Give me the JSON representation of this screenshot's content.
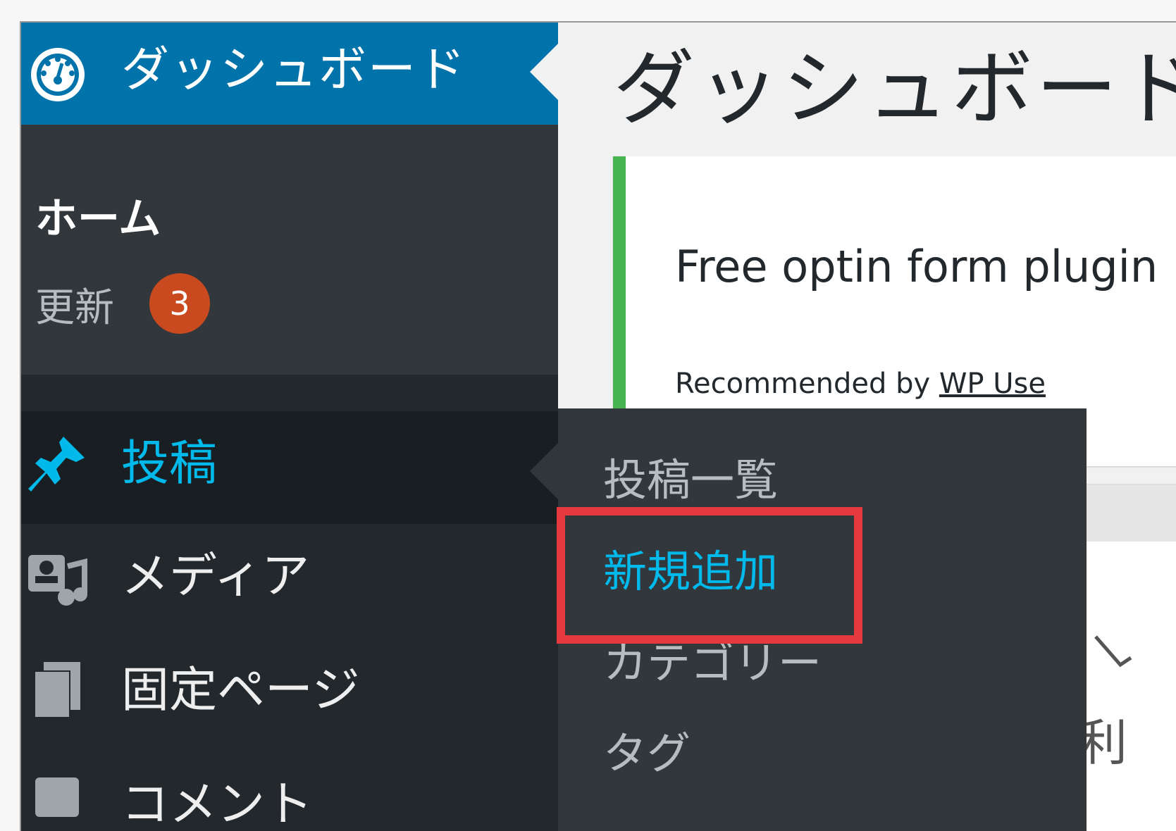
{
  "sidebar": {
    "dashboard": {
      "label": "ダッシュボード",
      "icon": "dashboard-gauge-icon",
      "submenu": {
        "home": "ホーム",
        "updates": "更新",
        "updates_count": "3"
      }
    },
    "items": [
      {
        "label": "投稿",
        "icon": "pushpin-icon",
        "active": true
      },
      {
        "label": "メディア",
        "icon": "media-icon"
      },
      {
        "label": "固定ページ",
        "icon": "pages-icon"
      },
      {
        "label": "コメント",
        "icon": "comments-icon"
      }
    ]
  },
  "flyout": {
    "items": [
      {
        "label": "投稿一覧"
      },
      {
        "label": "新規追加",
        "current": true
      },
      {
        "label": "カテゴリー"
      },
      {
        "label": "タグ"
      }
    ]
  },
  "main": {
    "page_title": "ダッシュボード",
    "notice": {
      "text": "Free optin form plugin",
      "sub_prefix": "Recommended by ",
      "sub_link": "WP Use"
    },
    "partial_text": "利"
  },
  "colors": {
    "sidebar_bg": "#23282d",
    "submenu_bg": "#32373c",
    "active_bg": "#0073aa",
    "active_text": "#00b9eb",
    "badge": "#ca4a1f",
    "notice_border": "#46b450",
    "highlight": "#e6383f"
  }
}
